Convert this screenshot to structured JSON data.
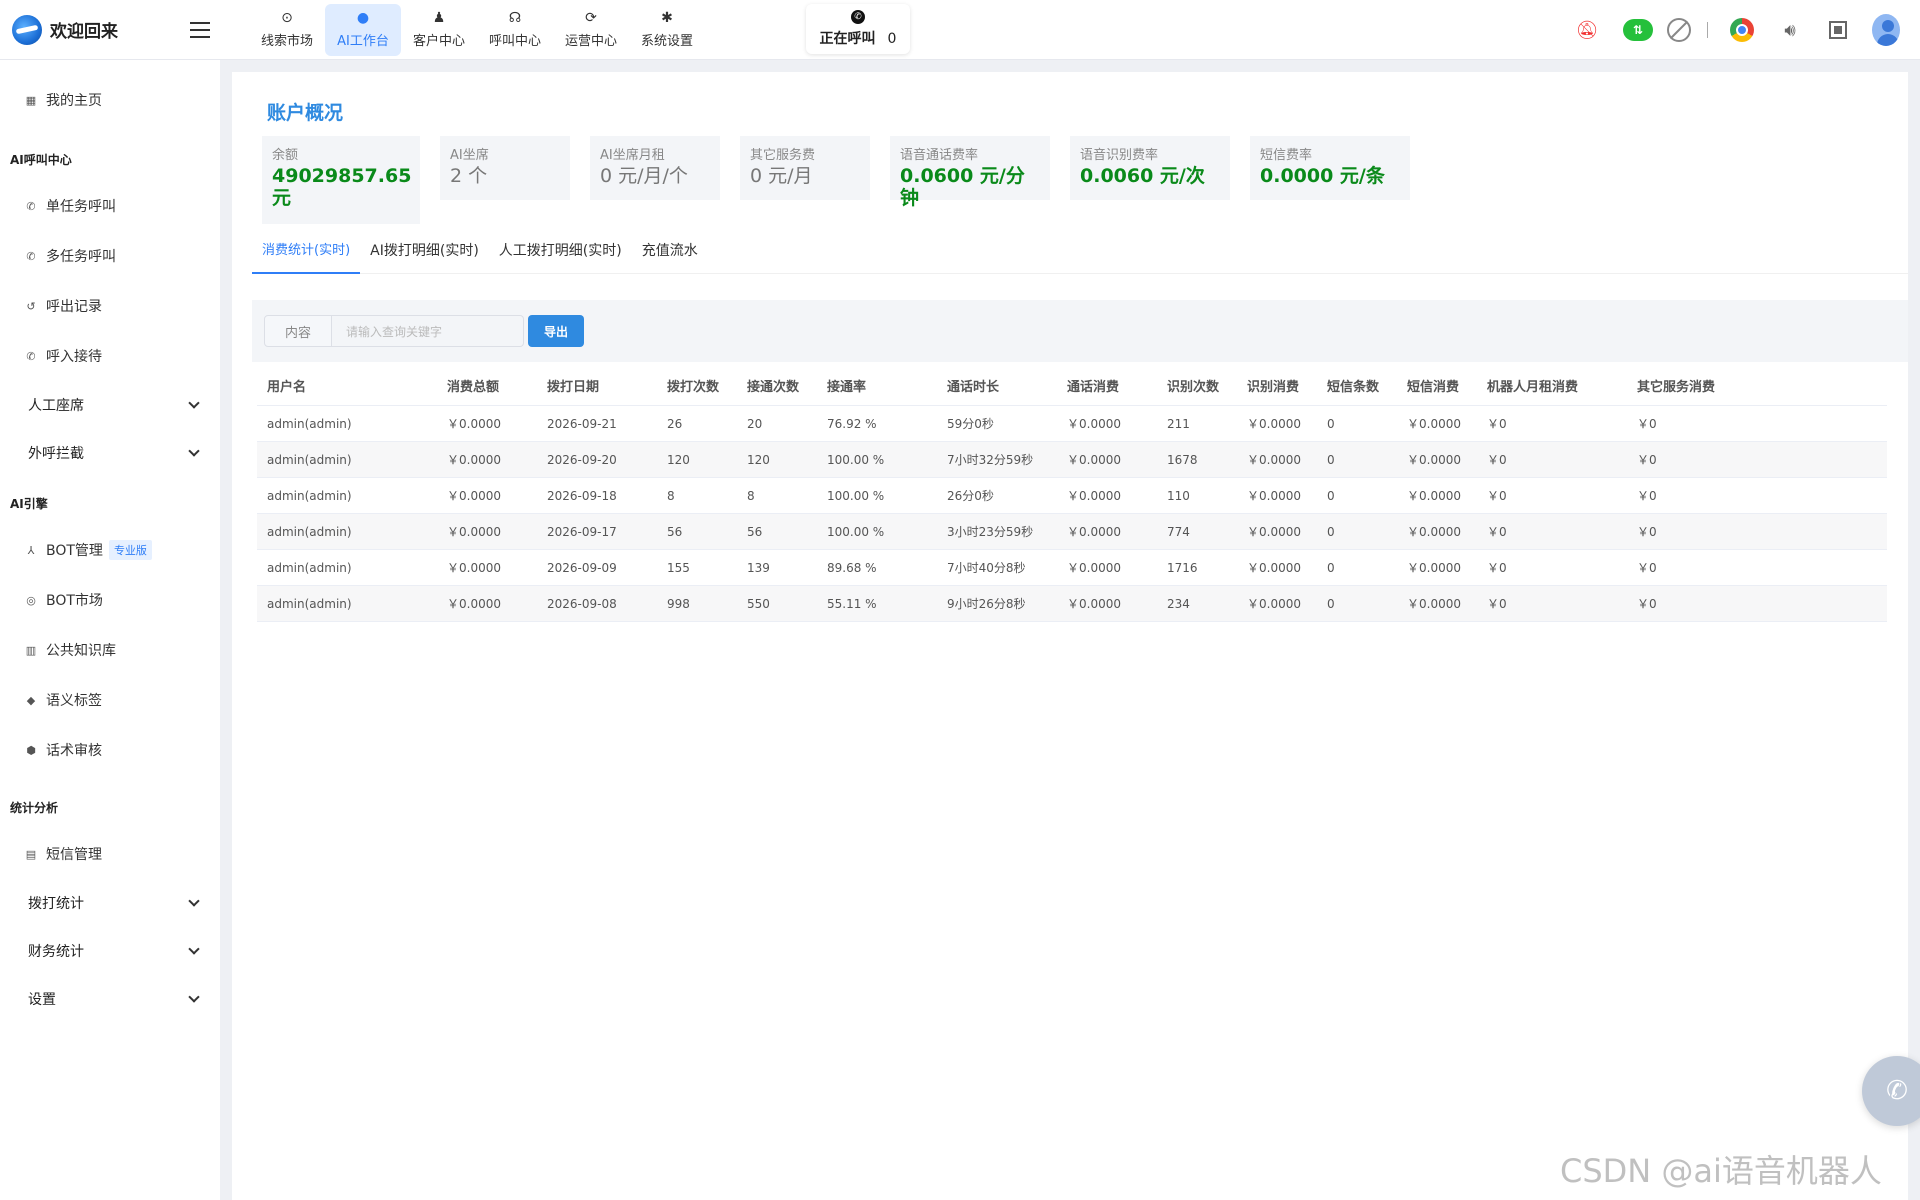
{
  "header": {
    "title": "欢迎回来",
    "nav": [
      {
        "label": "线索市场",
        "icon": "clue-icon"
      },
      {
        "label": "AI工作台",
        "icon": "ai-workbench-icon",
        "active": true
      },
      {
        "label": "客户中心",
        "icon": "customers-icon"
      },
      {
        "label": "呼叫中心",
        "icon": "headset-icon"
      },
      {
        "label": "运营中心",
        "icon": "operations-icon"
      },
      {
        "label": "系统设置",
        "icon": "gear-icon"
      }
    ],
    "calling": {
      "label": "正在呼叫",
      "count": "0"
    },
    "tools": [
      "bell-mute-icon",
      "cloud-sync-icon",
      "ban-icon",
      "chrome-icon",
      "speaker-icon",
      "fullscreen-icon",
      "avatar"
    ]
  },
  "sidebar": {
    "home": "我的主页",
    "group_ai_call": "AI呼叫中心",
    "single_task": "单任务呼叫",
    "multi_task": "多任务呼叫",
    "outbound_records": "呼出记录",
    "inbound": "呼入接待",
    "manual_seat": "人工座席",
    "outbound_block": "外呼拦截",
    "group_ai_engine": "AI引擎",
    "bot_manage": "BOT管理",
    "bot_badge": "专业版",
    "bot_market": "BOT市场",
    "knowledge": "公共知识库",
    "semantic_tags": "语义标签",
    "script_review": "话术审核",
    "group_stats": "统计分析",
    "sms_manage": "短信管理",
    "dial_stats": "拨打统计",
    "finance_stats": "财务统计",
    "settings": "设置"
  },
  "main": {
    "title": "账户概况",
    "cards": [
      {
        "label": "余额",
        "value": "49029857.65",
        "unit": "元"
      },
      {
        "label": "AI坐席",
        "value": "2 个"
      },
      {
        "label": "AI坐席月租",
        "value": "0 元/月/个"
      },
      {
        "label": "其它服务费",
        "value": "0 元/月"
      },
      {
        "label": "语音通话费率",
        "value": "0.0600 元/分钟"
      },
      {
        "label": "语音识别费率",
        "value": "0.0060 元/次"
      },
      {
        "label": "短信费率",
        "value": "0.0000 元/条"
      }
    ],
    "tabs": [
      "消费统计(实时)",
      "AI拨打明细(实时)",
      "人工拨打明细(实时)",
      "充值流水"
    ],
    "filter": {
      "prepend": "内容",
      "placeholder": "请输入查询关键字",
      "export": "导出"
    },
    "table": {
      "columns": [
        "用户名",
        "消费总额",
        "拨打日期",
        "拨打次数",
        "接通次数",
        "接通率",
        "通话时长",
        "通话消费",
        "识别次数",
        "识别消费",
        "短信条数",
        "短信消费",
        "机器人月租消费",
        "其它服务消费"
      ],
      "rows": [
        [
          "admin(admin)",
          "￥0.0000",
          "2026-09-21",
          "26",
          "20",
          "76.92 %",
          "59分0秒",
          "￥0.0000",
          "211",
          "￥0.0000",
          "0",
          "￥0.0000",
          "￥0",
          "￥0"
        ],
        [
          "admin(admin)",
          "￥0.0000",
          "2026-09-20",
          "120",
          "120",
          "100.00 %",
          "7小时32分59秒",
          "￥0.0000",
          "1678",
          "￥0.0000",
          "0",
          "￥0.0000",
          "￥0",
          "￥0"
        ],
        [
          "admin(admin)",
          "￥0.0000",
          "2026-09-18",
          "8",
          "8",
          "100.00 %",
          "26分0秒",
          "￥0.0000",
          "110",
          "￥0.0000",
          "0",
          "￥0.0000",
          "￥0",
          "￥0"
        ],
        [
          "admin(admin)",
          "￥0.0000",
          "2026-09-17",
          "56",
          "56",
          "100.00 %",
          "3小时23分59秒",
          "￥0.0000",
          "774",
          "￥0.0000",
          "0",
          "￥0.0000",
          "￥0",
          "￥0"
        ],
        [
          "admin(admin)",
          "￥0.0000",
          "2026-09-09",
          "155",
          "139",
          "89.68 %",
          "7小时40分8秒",
          "￥0.0000",
          "1716",
          "￥0.0000",
          "0",
          "￥0.0000",
          "￥0",
          "￥0"
        ],
        [
          "admin(admin)",
          "￥0.0000",
          "2026-09-08",
          "998",
          "550",
          "55.11 %",
          "9小时26分8秒",
          "￥0.0000",
          "234",
          "￥0.0000",
          "0",
          "￥0.0000",
          "￥0",
          "￥0"
        ]
      ]
    }
  },
  "watermark": "CSDN @ai语音机器人"
}
